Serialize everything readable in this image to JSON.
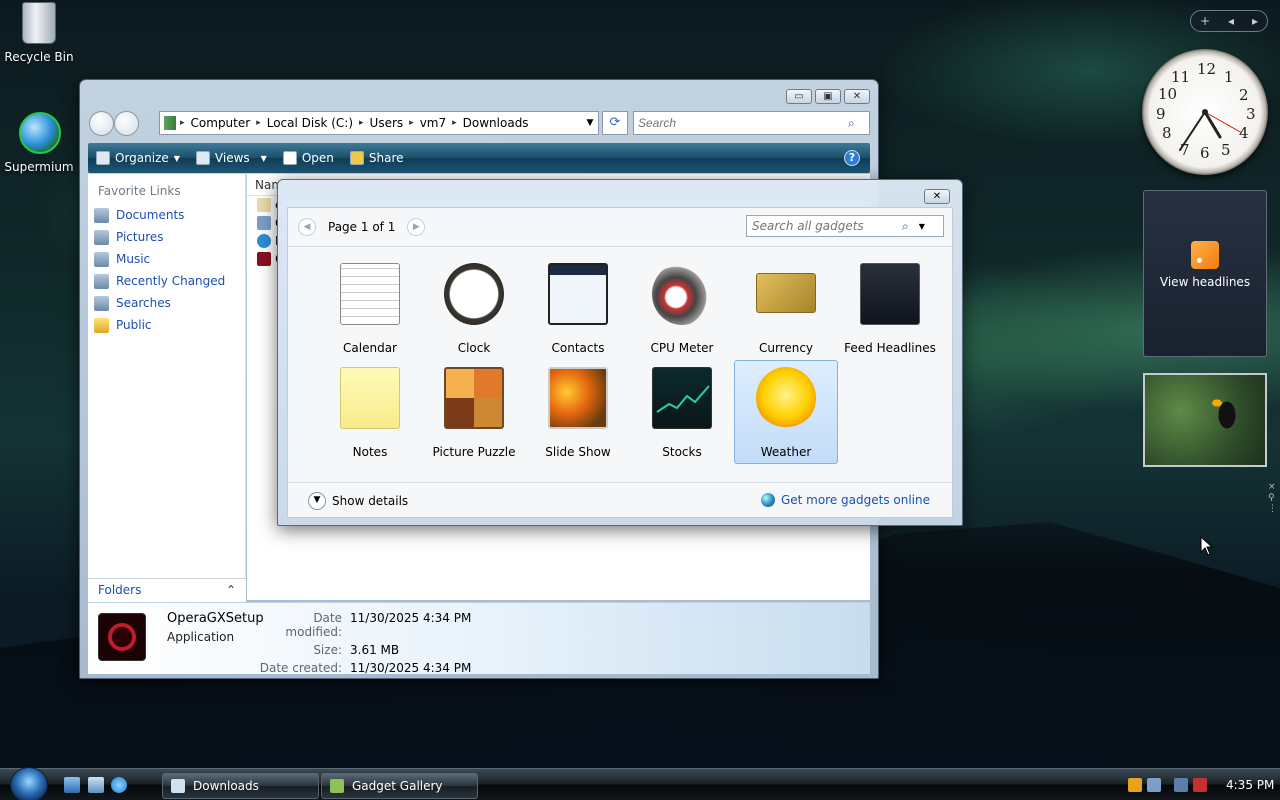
{
  "desktop": {
    "icons": [
      {
        "label": "Recycle Bin",
        "icon": "recycle-bin-icon"
      },
      {
        "label": "Supermium",
        "icon": "supermium-browser-icon"
      }
    ]
  },
  "sidebar": {
    "controls": {
      "add": "+",
      "prev": "◂",
      "next": "▸"
    },
    "clock_numbers": [
      "12",
      "1",
      "2",
      "3",
      "4",
      "5",
      "6",
      "7",
      "8",
      "9",
      "10",
      "11"
    ],
    "feed_gadget_label": "View headlines",
    "handles": [
      "×",
      "⚲",
      "⋮"
    ]
  },
  "explorer": {
    "window_buttons": {
      "minimize": "▭",
      "maximize": "▣",
      "close": "✕"
    },
    "breadcrumb": [
      "Computer",
      "Local Disk (C:)",
      "Users",
      "vm7",
      "Downloads"
    ],
    "breadcrumb_sep": "▸",
    "search_placeholder": "Search",
    "toolbar": {
      "organize": "Organize",
      "views": "Views",
      "open": "Open",
      "share": "Share",
      "help": "?"
    },
    "favorite_links_title": "Favorite Links",
    "favorite_links": [
      "Documents",
      "Pictures",
      "Music",
      "Recently Changed",
      "Searches",
      "Public"
    ],
    "folders_label": "Folders",
    "column_header": "Nam",
    "files": [
      "c",
      "C",
      "L",
      "C"
    ],
    "details": {
      "file_name": "OperaGXSetup",
      "file_type": "Application",
      "rows": [
        {
          "label": "Date modified:",
          "value": "11/30/2025 4:34 PM"
        },
        {
          "label": "Size:",
          "value": "3.61 MB"
        },
        {
          "label": "Date created:",
          "value": "11/30/2025 4:34 PM"
        }
      ]
    }
  },
  "gallery": {
    "close": "✕",
    "pager": "Page 1 of 1",
    "search_placeholder": "Search all gadgets",
    "gadgets": [
      {
        "label": "Calendar",
        "icon": "calendar-gadget-icon"
      },
      {
        "label": "Clock",
        "icon": "clock-gadget-icon"
      },
      {
        "label": "Contacts",
        "icon": "contacts-gadget-icon"
      },
      {
        "label": "CPU Meter",
        "icon": "cpu-meter-gadget-icon"
      },
      {
        "label": "Currency",
        "icon": "currency-gadget-icon"
      },
      {
        "label": "Feed Headlines",
        "icon": "feed-headlines-gadget-icon"
      },
      {
        "label": "Notes",
        "icon": "notes-gadget-icon"
      },
      {
        "label": "Picture Puzzle",
        "icon": "picture-puzzle-gadget-icon"
      },
      {
        "label": "Slide Show",
        "icon": "slide-show-gadget-icon"
      },
      {
        "label": "Stocks",
        "icon": "stocks-gadget-icon"
      },
      {
        "label": "Weather",
        "icon": "weather-gadget-icon"
      }
    ],
    "selected_gadget": "Weather",
    "show_details": "Show details",
    "more_gadgets_link": "Get more gadgets online"
  },
  "taskbar": {
    "buttons": [
      {
        "label": "Downloads",
        "icon": "folder-icon"
      },
      {
        "label": "Gadget Gallery",
        "icon": "gadget-gallery-icon"
      }
    ],
    "clock": "4:35 PM"
  },
  "colors": {
    "link": "#1d4fae",
    "toolbar": "#1a4f6a",
    "selection": "#c3dcf7"
  }
}
